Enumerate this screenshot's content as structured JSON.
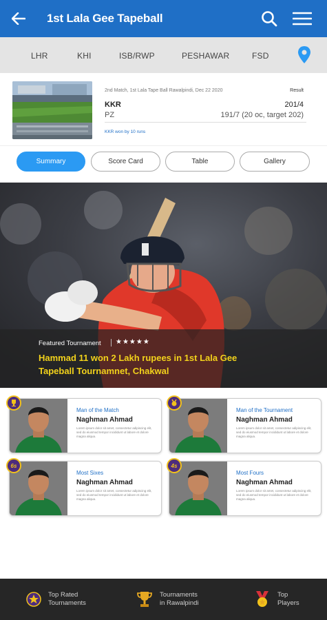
{
  "appbar": {
    "title": "1st Lala Gee Tapeball",
    "back_icon": "arrow-left-icon",
    "search_icon": "search-icon",
    "menu_icon": "hamburger-menu-icon",
    "color": "#1f6fc6"
  },
  "cities": [
    {
      "label": "LHR"
    },
    {
      "label": "KHI"
    },
    {
      "label": "ISB/RWP"
    },
    {
      "label": "PESHAWAR"
    },
    {
      "label": "FSD"
    }
  ],
  "location_icon": "map-pin-icon",
  "match": {
    "meta": "2nd Match, 1st Lala Tape Ball Rawalpindi, Dec 22 2020",
    "result_label": "Result",
    "team1": "KKR",
    "team1_score": "201/4",
    "team2": "PZ",
    "team2_score": "191/7 (20 oc, target 202)",
    "win_note": "KKR won by 10 runs"
  },
  "tabs": [
    {
      "label": "Summary",
      "active": true
    },
    {
      "label": "Score Card",
      "active": false
    },
    {
      "label": "Table",
      "active": false
    },
    {
      "label": "Gallery",
      "active": false
    }
  ],
  "featured": {
    "label": "Featured Tournament",
    "stars": "★★★★★",
    "headline": "Hammad 11 won 2 Lakh rupees in 1st Lala Gee Tapeball Tournamnet, Chakwal"
  },
  "awards": [
    {
      "title": "Man of the Match",
      "name": "Naghman Ahmad",
      "badge": "trophy",
      "desc": "Lorem ipsum dolor sit amet, consectetur adipiscing elit, sed do eiusmod tempor incididunt ut labore et dolore magna aliqua."
    },
    {
      "title": "Man of the Tournament",
      "name": "Naghman Ahmad",
      "badge": "medal",
      "desc": "Lorem ipsum dolor sit amet, consectetur adipiscing elit, sed do eiusmod tempor incididunt ut labore et dolore magna aliqua."
    },
    {
      "title": "Most Sixes",
      "name": "Naghman Ahmad",
      "badge": "6s",
      "desc": "Lorem ipsum dolor sit amet, consectetur adipiscing elit, sed do eiusmod tempor incididunt ut labore et dolore magna aliqua."
    },
    {
      "title": "Most Fours",
      "name": "Naghman Ahmad",
      "badge": "4s",
      "desc": "Lorem ipsum dolor sit amet, consectetur adipiscing elit, sed do eiusmod tempor incididunt ut labore et dolore magna aliqua."
    }
  ],
  "bottom_nav": [
    {
      "label_line1": "Top Rated",
      "label_line2": "Tournaments",
      "icon": "star-badge-icon"
    },
    {
      "label_line1": "Tournaments",
      "label_line2": "in Rawalpindi",
      "icon": "trophy-icon"
    },
    {
      "label_line1": "Top",
      "label_line2": "Players",
      "icon": "medal-icon"
    }
  ],
  "colors": {
    "accent": "#2b9af3",
    "headline_yellow": "#f2d21b",
    "badge_purple": "#4d2c7d",
    "nav_bg": "#262626"
  }
}
